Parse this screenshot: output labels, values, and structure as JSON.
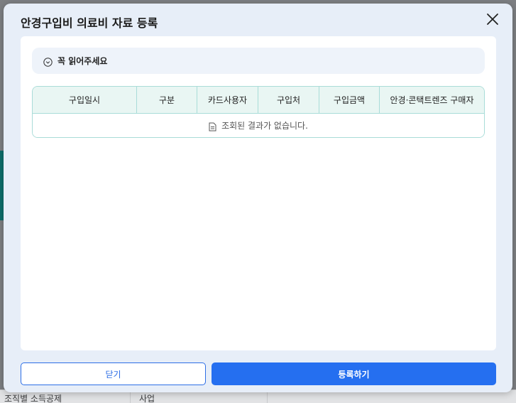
{
  "background": {
    "footer_left": "조직별 소득공제",
    "footer_right": "사업"
  },
  "modal": {
    "title": "안경구입비 의료비 자료 등록",
    "close_icon": "close-icon",
    "notice": {
      "icon": "chevron-down-circle-icon",
      "text": "꼭 읽어주세요"
    },
    "table": {
      "columns": [
        "구입일시",
        "구분",
        "카드사용자",
        "구입처",
        "구입금액",
        "안경·콘택트렌즈 구매자"
      ],
      "empty_icon": "document-icon",
      "empty_text": "조회된 결과가 없습니다."
    },
    "buttons": {
      "close_label": "닫기",
      "register_label": "등록하기"
    }
  },
  "colors": {
    "primary": "#256ff0",
    "table_border": "#a9dcd8",
    "table_header_bg": "#e9f6f3",
    "modal_bg": "#e7eef8"
  }
}
